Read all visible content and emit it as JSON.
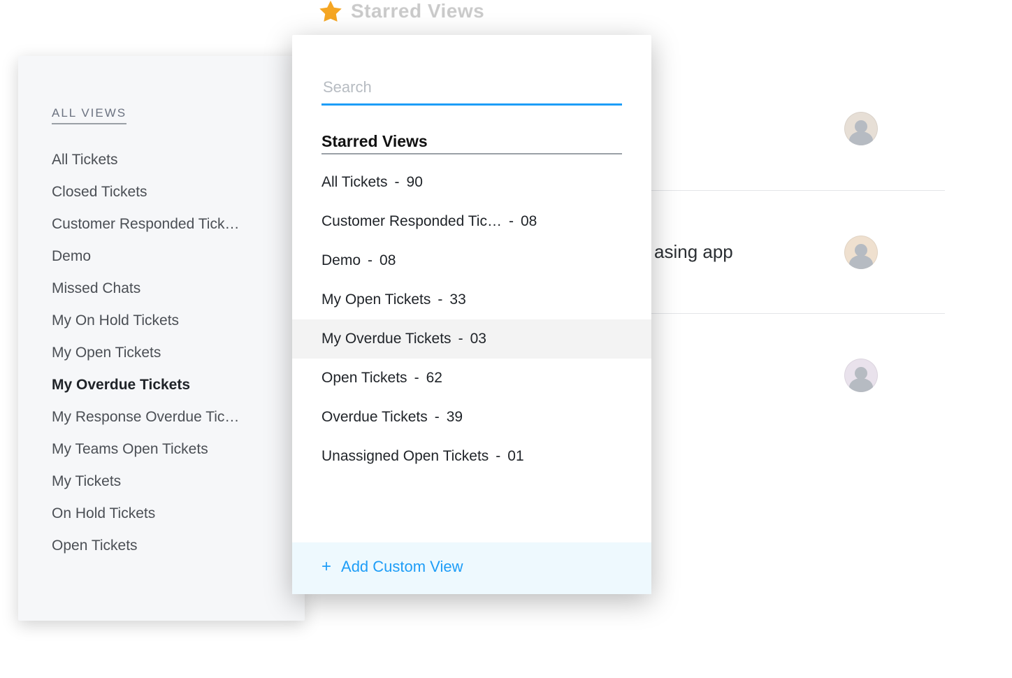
{
  "header": {
    "star_icon": "star-icon",
    "shadow_text": "Starred Views"
  },
  "sidebar": {
    "section_title": "ALL VIEWS",
    "items": [
      {
        "label": "All Tickets",
        "active": false
      },
      {
        "label": "Closed Tickets",
        "active": false
      },
      {
        "label": "Customer Responded Tick…",
        "active": false
      },
      {
        "label": "Demo",
        "active": false
      },
      {
        "label": "Missed Chats",
        "active": false
      },
      {
        "label": "My On Hold Tickets",
        "active": false
      },
      {
        "label": "My Open Tickets",
        "active": false
      },
      {
        "label": "My Overdue Tickets",
        "active": true
      },
      {
        "label": "My Response Overdue Tic…",
        "active": false
      },
      {
        "label": "My Teams Open Tickets",
        "active": false
      },
      {
        "label": "My Tickets",
        "active": false
      },
      {
        "label": "On Hold Tickets",
        "active": false
      },
      {
        "label": "Open Tickets",
        "active": false
      }
    ]
  },
  "popover": {
    "search_placeholder": "Search",
    "section_title": "Starred Views",
    "separator": "-",
    "items": [
      {
        "label": "All Tickets",
        "count": "90",
        "highlight": false
      },
      {
        "label": "Customer Responded Tic…",
        "count": "08",
        "highlight": false
      },
      {
        "label": "Demo",
        "count": "08",
        "highlight": false
      },
      {
        "label": "My Open Tickets",
        "count": "33",
        "highlight": false
      },
      {
        "label": "My Overdue Tickets",
        "count": "03",
        "highlight": true
      },
      {
        "label": "Open Tickets",
        "count": "62",
        "highlight": false
      },
      {
        "label": "Overdue Tickets",
        "count": "39",
        "highlight": false
      },
      {
        "label": "Unassigned Open Tickets",
        "count": "01",
        "highlight": false
      }
    ],
    "add_label": "Add Custom View"
  },
  "background_list": {
    "rows": [
      {
        "title_fragment": ""
      },
      {
        "title_fragment": "asing app"
      },
      {
        "title_fragment": ""
      }
    ]
  }
}
